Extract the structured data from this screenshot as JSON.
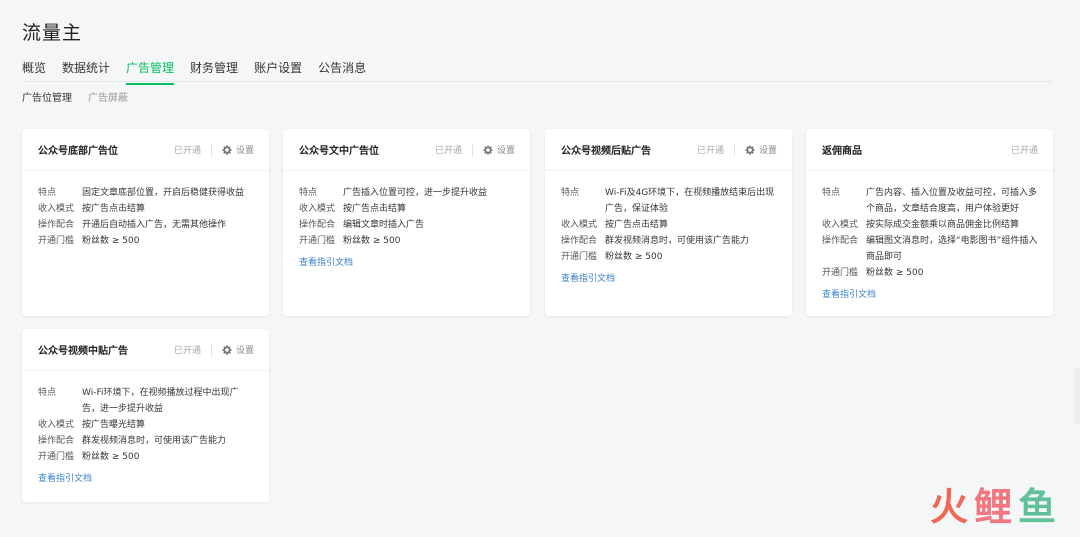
{
  "app": {
    "title": "流量主"
  },
  "main_tabs": [
    {
      "label": "概览",
      "active": false
    },
    {
      "label": "数据统计",
      "active": false
    },
    {
      "label": "广告管理",
      "active": true
    },
    {
      "label": "财务管理",
      "active": false
    },
    {
      "label": "账户设置",
      "active": false
    },
    {
      "label": "公告消息",
      "active": false
    }
  ],
  "sub_tabs": [
    {
      "label": "广告位管理",
      "active": true
    },
    {
      "label": "广告屏蔽",
      "active": false
    }
  ],
  "labels": {
    "feature": "特点",
    "income_mode": "收入模式",
    "operation": "操作配合",
    "threshold": "开通门槛",
    "settings": "设置",
    "doc_link": "查看指引文档"
  },
  "cards": [
    {
      "title": "公众号底部广告位",
      "status": "已开通",
      "feature": "固定文章底部位置，开启后稳健获得收益",
      "income_mode": "按广告点击结算",
      "operation": "开通后自动插入广告，无需其他操作",
      "threshold": "粉丝数 ≥ 500"
    },
    {
      "title": "公众号文中广告位",
      "status": "已开通",
      "feature": "广告插入位置可控，进一步提升收益",
      "income_mode": "按广告点击结算",
      "operation": "编辑文章时插入广告",
      "threshold": "粉丝数 ≥ 500"
    },
    {
      "title": "公众号视频后贴广告",
      "status": "已开通",
      "feature": "Wi-Fi及4G环境下，在视频播放结束后出现广告，保证体验",
      "income_mode": "按广告点击结算",
      "operation": "群发视频消息时，可使用该广告能力",
      "threshold": "粉丝数 ≥ 500"
    },
    {
      "title": "返佣商品",
      "status": "已开通",
      "feature": "广告内容、插入位置及收益可控，可插入多个商品，文章结合度高，用户体验更好",
      "income_mode": "按实际成交金额乘以商品佣金比例结算",
      "operation": "编辑图文消息时，选择“电影图书”组件插入商品即可",
      "threshold": "粉丝数 ≥ 500"
    },
    {
      "title": "公众号视频中贴广告",
      "status": "已开通",
      "feature": "Wi-Fi环境下，在视频播放过程中出现广告，进一步提升收益",
      "income_mode": "按广告曝光结算",
      "operation": "群发视频消息时，可使用该广告能力",
      "threshold": "粉丝数 ≥ 500"
    }
  ],
  "watermark": {
    "c1": "火",
    "c2": "鲤",
    "c3": "鱼"
  }
}
